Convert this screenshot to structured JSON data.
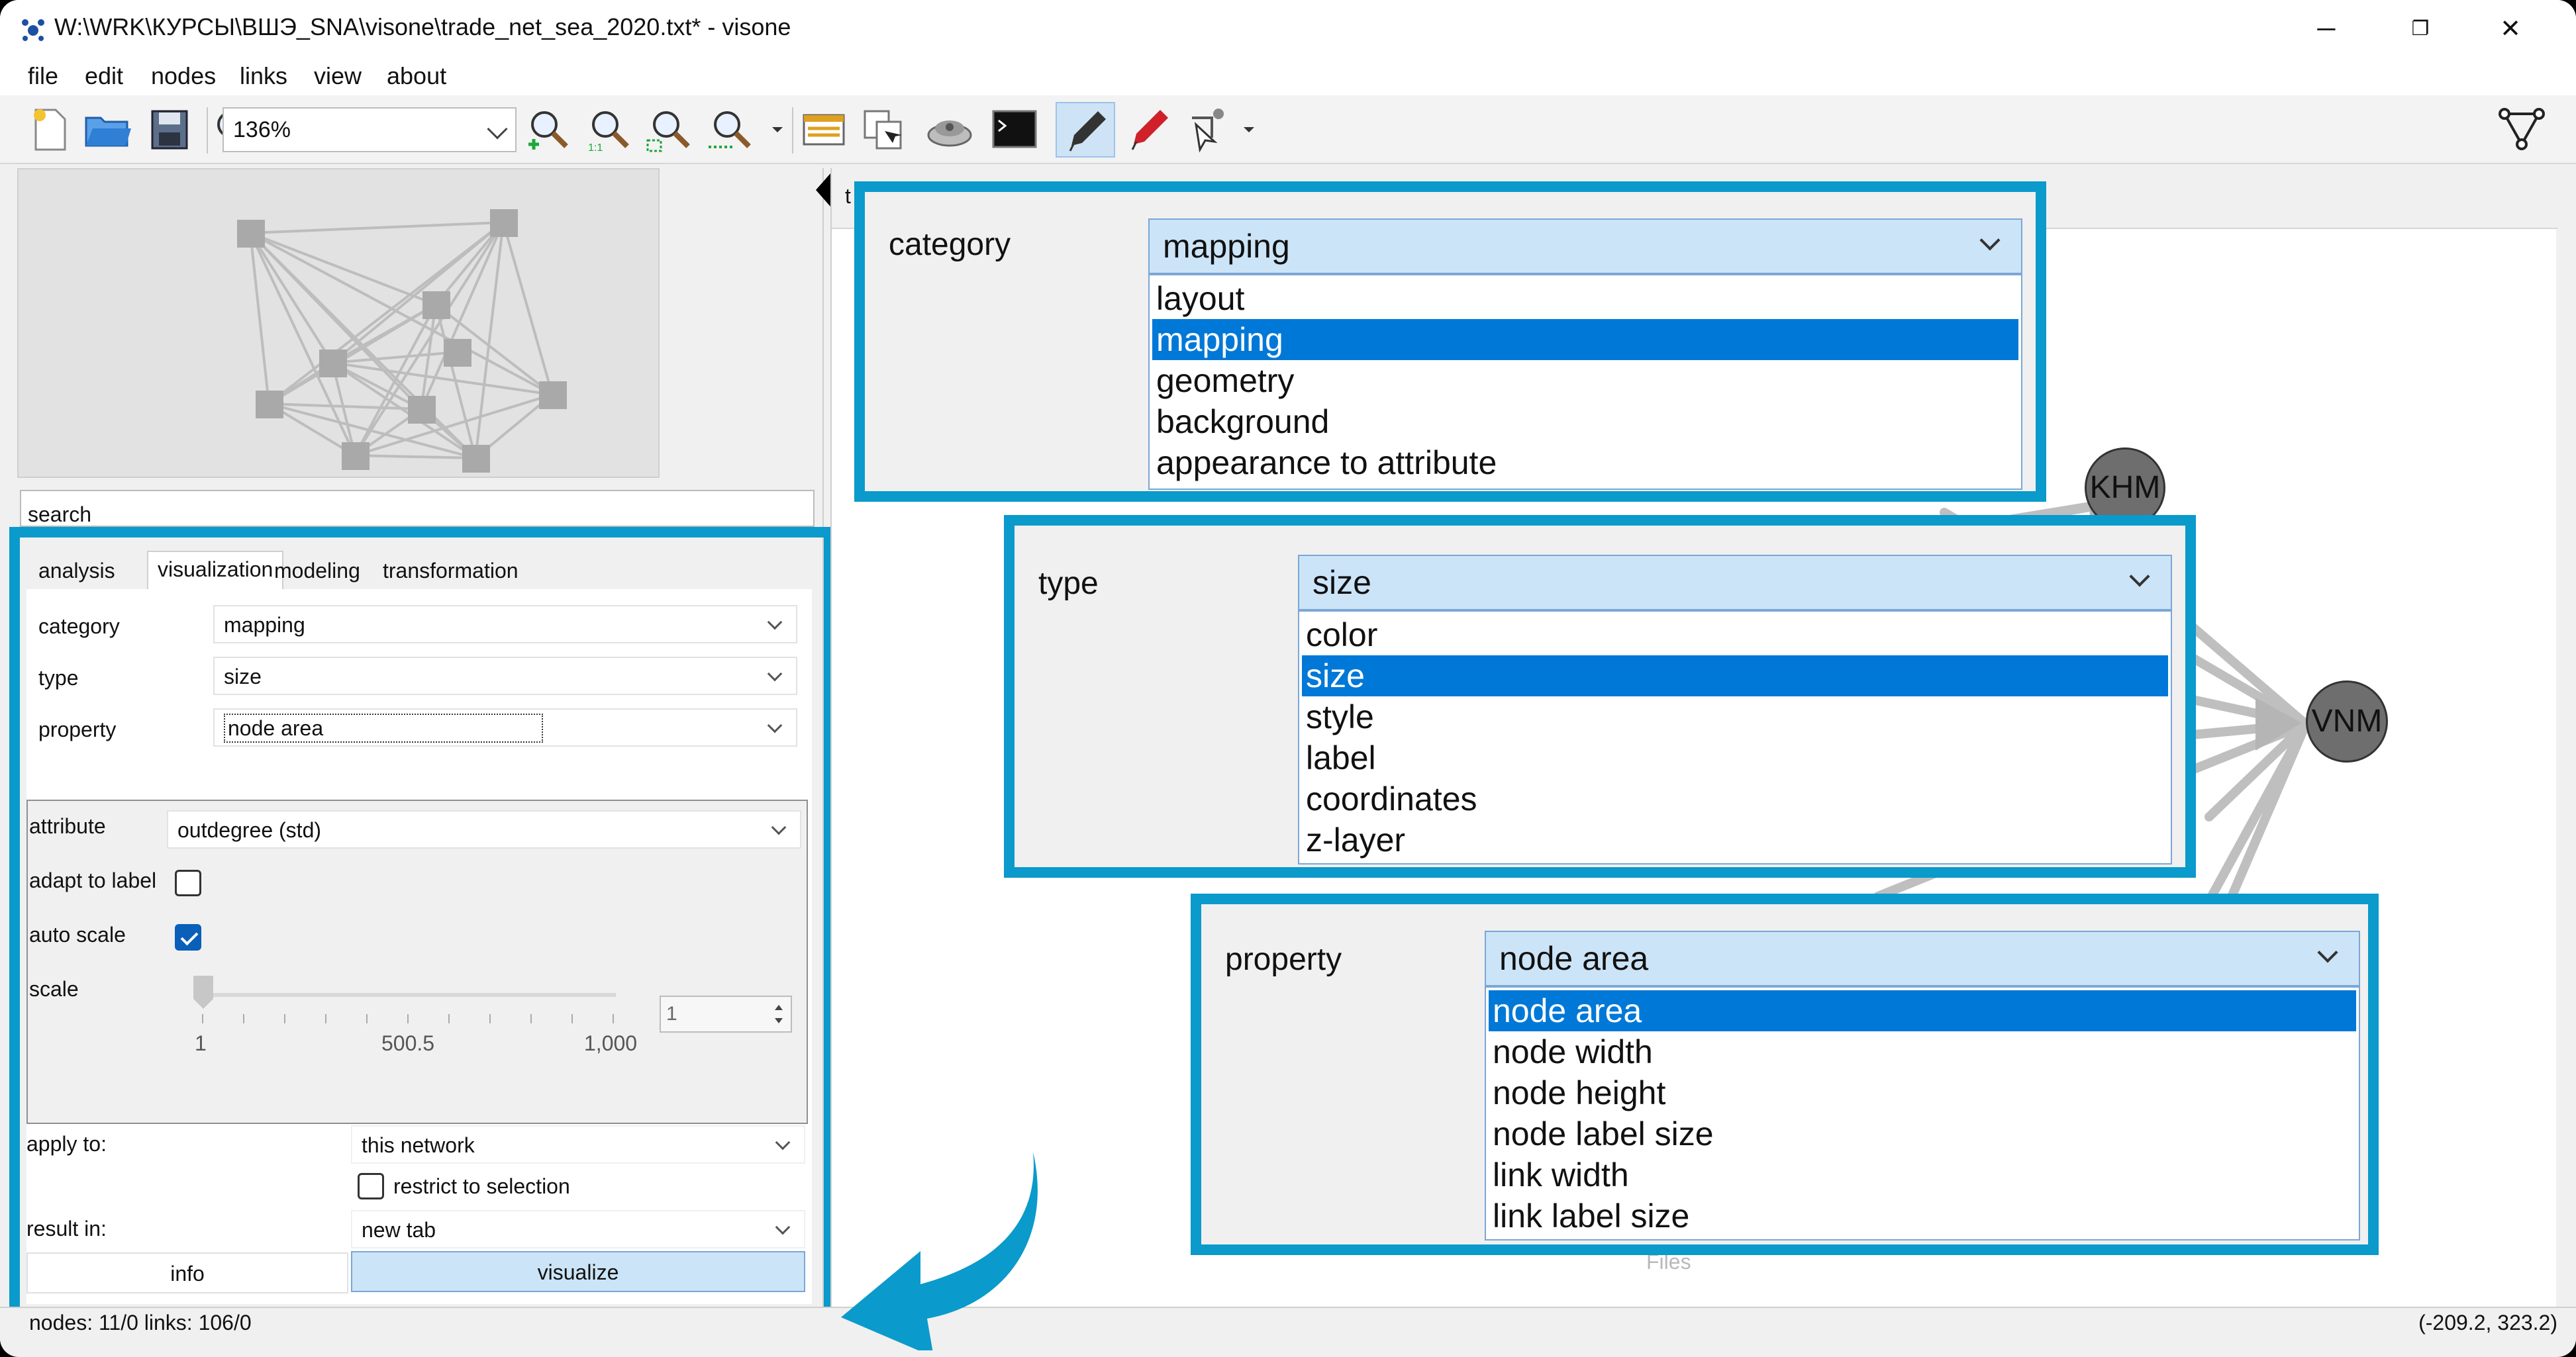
{
  "window": {
    "title": "W:\\WRK\\КУРСЫ\\ВШЭ_SNA\\visone\\trade_net_sea_2020.txt* - visone",
    "minimize": "─",
    "maximize": "❐",
    "close": "✕"
  },
  "menu": [
    "file",
    "edit",
    "nodes",
    "links",
    "view",
    "about"
  ],
  "toolbar": {
    "zoom_value": "136%"
  },
  "search": {
    "placeholder": "search"
  },
  "tabs": [
    "analysis",
    "visualization",
    "modeling",
    "transformation"
  ],
  "panel": {
    "category_label": "category",
    "category_value": "mapping",
    "type_label": "type",
    "type_value": "size",
    "property_label": "property",
    "property_value": "node area",
    "attribute_label": "attribute",
    "attribute_value": "outdegree (std)",
    "adapt_label": "adapt to label",
    "adapt_checked": false,
    "autoscale_label": "auto scale",
    "autoscale_checked": true,
    "scale_label": "scale",
    "scale_ticks": [
      "1",
      "500.5",
      "1,000"
    ],
    "scale_value": "1",
    "apply_label": "apply to:",
    "apply_value": "this network",
    "restrict_label": "restrict to selection",
    "result_label": "result in:",
    "result_value": "new tab",
    "info_button": "info",
    "visualize_button": "visualize"
  },
  "status": {
    "left": "nodes: 11/0  links: 106/0",
    "right": "(-209.2, 323.2)"
  },
  "canvas": {
    "tab_fragment": "t",
    "nodes": [
      "KHM",
      "VNM"
    ],
    "faded_text": "Files"
  },
  "callouts": {
    "category": {
      "label": "category",
      "value": "mapping",
      "options": [
        "layout",
        "mapping",
        "geometry",
        "background",
        "appearance to attribute"
      ],
      "selected": 1
    },
    "type": {
      "label": "type",
      "value": "size",
      "options": [
        "color",
        "size",
        "style",
        "label",
        "coordinates",
        "z-layer"
      ],
      "selected": 1
    },
    "property": {
      "label": "property",
      "value": "node area",
      "options": [
        "node area",
        "node width",
        "node height",
        "node label size",
        "link width",
        "link label size"
      ],
      "selected": 0
    }
  },
  "colors": {
    "accent_frame": "#0a9acb",
    "selection": "#0078d7",
    "dropdown_header": "#cce4f7"
  }
}
